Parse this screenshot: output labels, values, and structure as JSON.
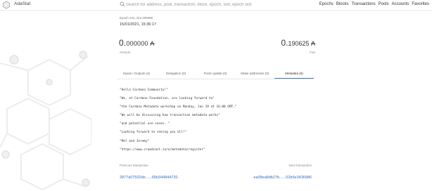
{
  "app": {
    "name": "AdaStat"
  },
  "search": {
    "placeholder": "Search for address, pool, transaction, block, epoch, slot, epoch slot"
  },
  "nav": [
    "Epochs",
    "Blocks",
    "Transactions",
    "Pools",
    "Accounts",
    "Favorites"
  ],
  "tx": {
    "epoch_slot": "Epoch 241, slot 405086",
    "datetime": "15/01/2021, 15:36:17",
    "amount_main": "0.",
    "amount_small": "000000 ₳",
    "amount_label": "Amount",
    "fee_main": "0.",
    "fee_small": "190625 ₳",
    "fee_label": "Fee"
  },
  "tabs": [
    "Inputs / Outputs (4)",
    "Delegation (0)",
    "Pools update (0)",
    "Stake addresses (0)",
    "Metadata (8)"
  ],
  "active_tab_index": 4,
  "metadata": [
    "\"Hello Cardano Community!\"",
    "\"We, at Cardano Foundation, are looking forward to\"",
    "\"the Cardano Metadata workshop on Monday, Jan 19 at 16:00 GMT.\"",
    "\"We will be discussing how transaction metadata works\"",
    "\"and potential use cases. \"",
    "\"Looking forward to seeing you all!\"",
    "\"Mel and Jeremy\"",
    "\"https://www.crowdcast.io/e/metadata/register\""
  ],
  "prev": {
    "label": "Previous transaction",
    "hash": "2877a07502de......65b344844720"
  },
  "next": {
    "label": "Next transaction",
    "hash": "ea08ea8db27b......02b5e3436986"
  },
  "colors": {
    "accent": "#3d7fc9",
    "link": "#2f6fc4"
  }
}
